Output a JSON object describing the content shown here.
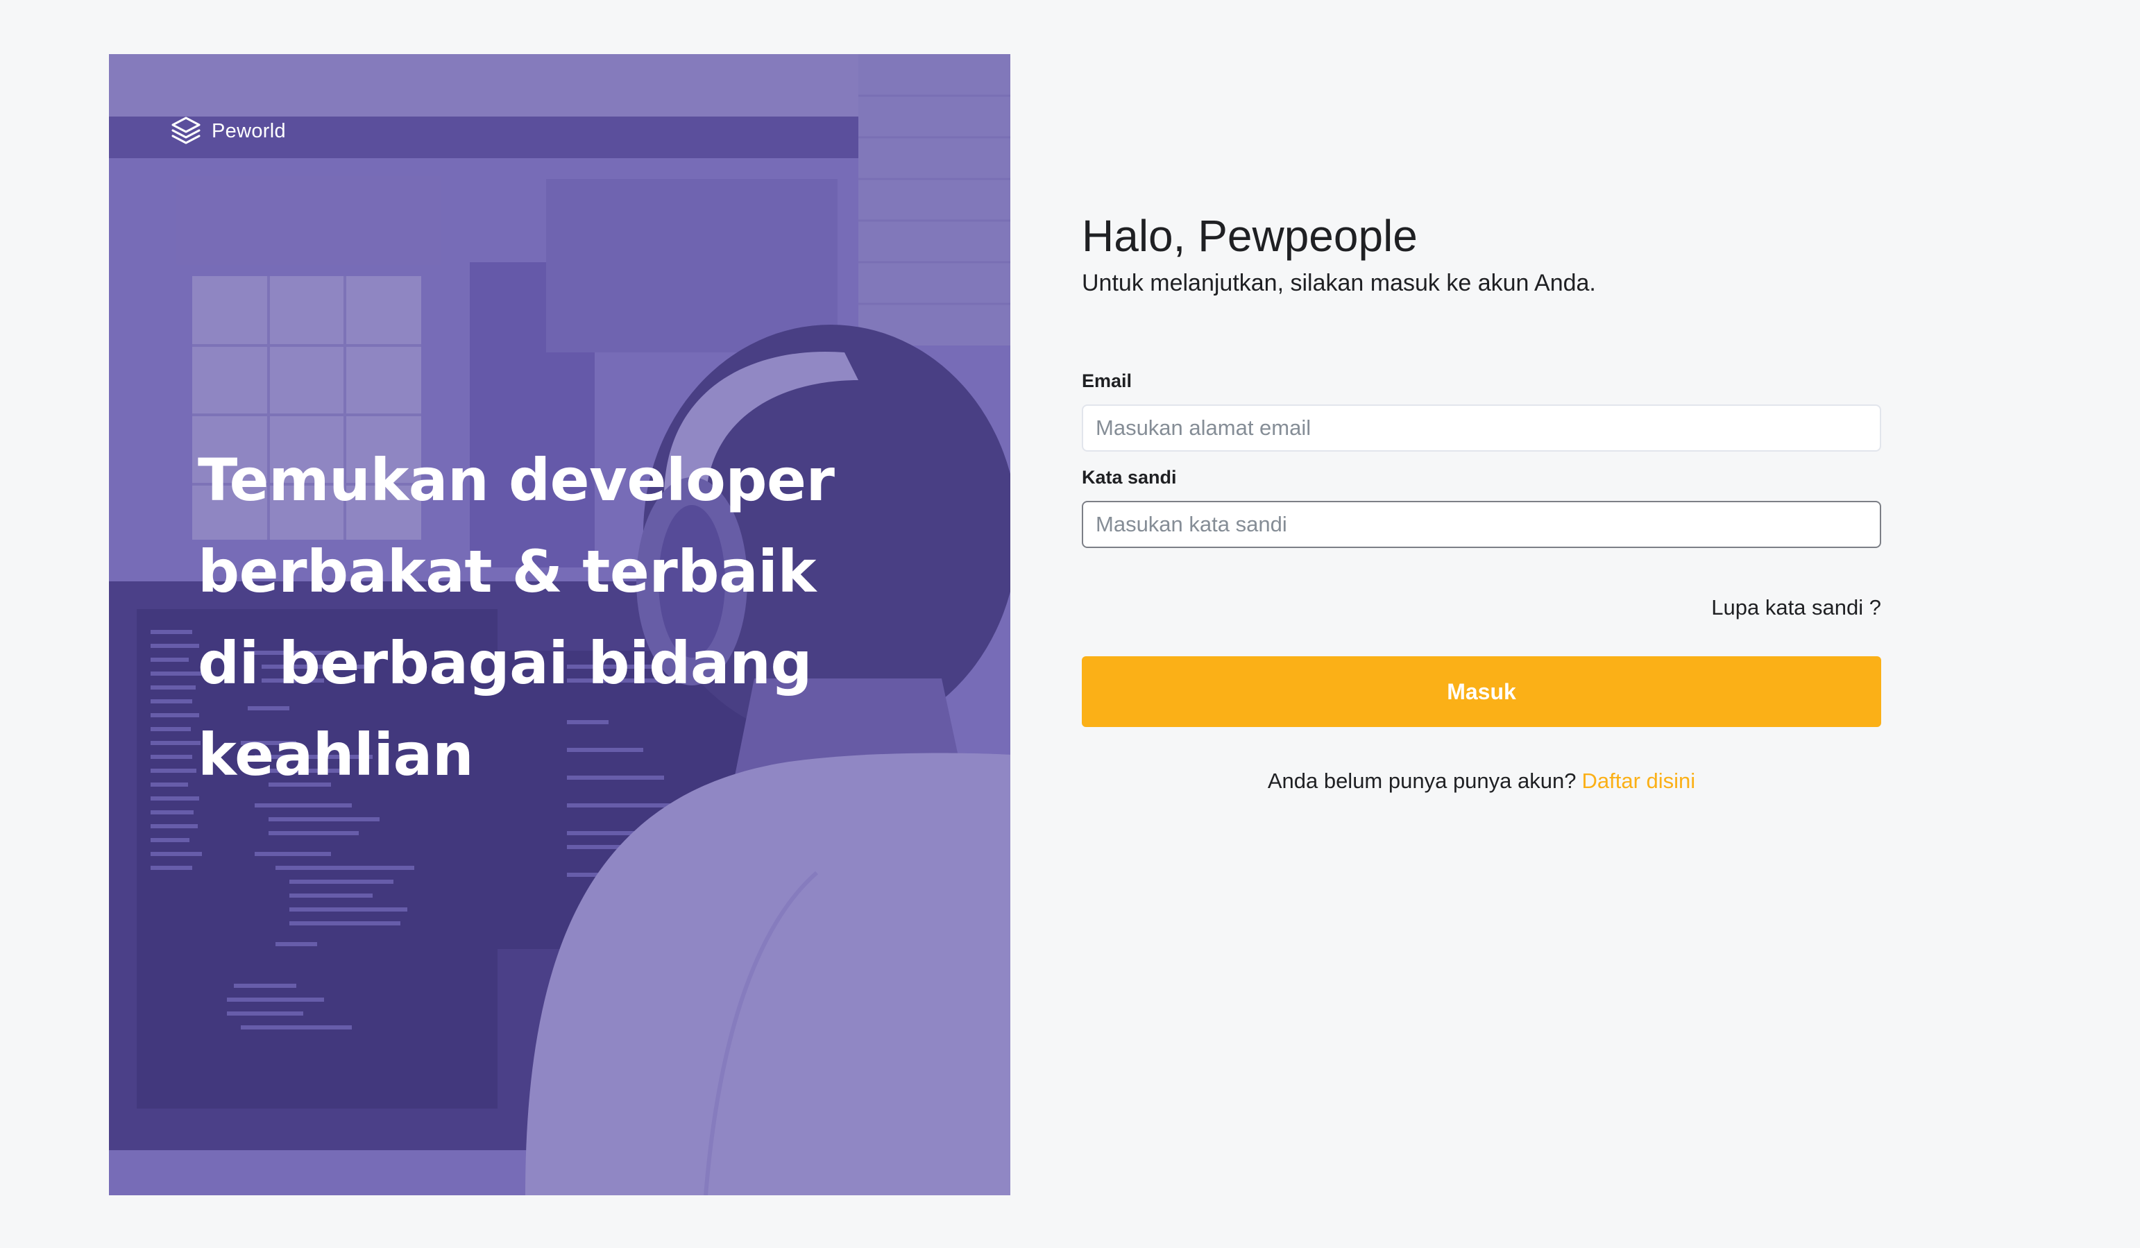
{
  "brand": {
    "name": "Peworld",
    "logo_icon": "layers-icon"
  },
  "hero": {
    "headline": "Temukan developer berbakat & terbaik di berbagai bidang keahlian",
    "overlay_color": "#5E50A1"
  },
  "form": {
    "title": "Halo, Pewpeople",
    "subtitle": "Untuk melanjutkan, silakan masuk ke akun Anda.",
    "email_label": "Email",
    "email_placeholder": "Masukan alamat email",
    "password_label": "Kata sandi",
    "password_placeholder": "Masukan kata sandi",
    "forgot_label": "Lupa kata sandi ?",
    "submit_label": "Masuk",
    "register_prompt": "Anda belum punya punya akun?",
    "register_link": "Daftar disini"
  },
  "colors": {
    "accent": "#FBB017",
    "page_background": "#F6F7F8",
    "text": "#1F2023"
  }
}
